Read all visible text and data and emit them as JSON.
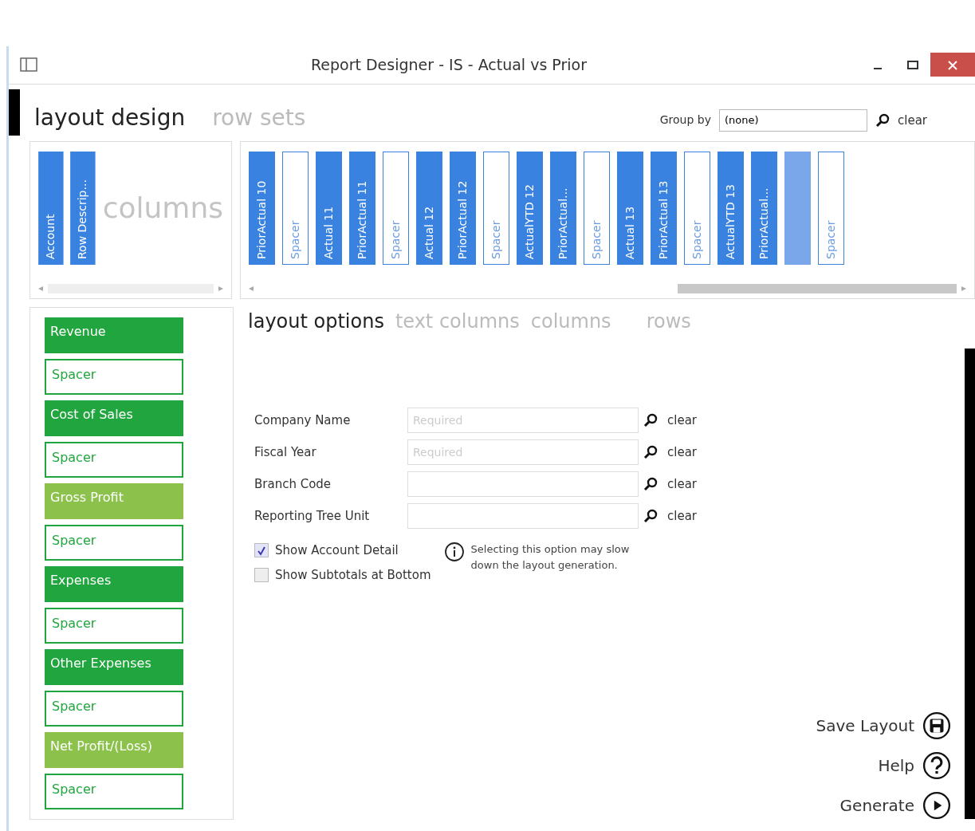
{
  "window": {
    "title": "Report Designer - IS - Actual vs Prior"
  },
  "main_tabs": [
    {
      "label": "layout design",
      "selected": true
    },
    {
      "label": "row sets",
      "selected": false
    }
  ],
  "group_by": {
    "label": "Group by",
    "value": "(none)",
    "clear": "clear"
  },
  "text_columns": {
    "placeholder": "columns",
    "items": [
      {
        "label": "Account",
        "kind": "column",
        "selected": false
      },
      {
        "label": "Row Descrip...",
        "kind": "column",
        "selected": false
      }
    ]
  },
  "columns": [
    {
      "label": "PriorActual 10",
      "kind": "column",
      "selected": false
    },
    {
      "label": "Spacer",
      "kind": "spacer",
      "selected": false
    },
    {
      "label": "Actual 11",
      "kind": "column",
      "selected": false
    },
    {
      "label": "PriorActual 11",
      "kind": "column",
      "selected": false
    },
    {
      "label": "Spacer",
      "kind": "spacer",
      "selected": false
    },
    {
      "label": "Actual 12",
      "kind": "column",
      "selected": false
    },
    {
      "label": "PriorActual 12",
      "kind": "column",
      "selected": false
    },
    {
      "label": "Spacer",
      "kind": "spacer",
      "selected": false
    },
    {
      "label": "ActualYTD 12",
      "kind": "column",
      "selected": false
    },
    {
      "label": "PriorActual...",
      "kind": "column",
      "selected": false
    },
    {
      "label": "Spacer",
      "kind": "spacer",
      "selected": false
    },
    {
      "label": "Actual 13",
      "kind": "column",
      "selected": false
    },
    {
      "label": "PriorActual 13",
      "kind": "column",
      "selected": false
    },
    {
      "label": "Spacer",
      "kind": "spacer",
      "selected": false
    },
    {
      "label": "ActualYTD 13",
      "kind": "column",
      "selected": false
    },
    {
      "label": "PriorActual...",
      "kind": "column",
      "selected": false
    },
    {
      "kind": "column",
      "selected": true
    },
    {
      "label": "Spacer",
      "kind": "spacer",
      "selected": false
    }
  ],
  "rows": [
    {
      "label": "Revenue",
      "kind": "total"
    },
    {
      "label": "Spacer",
      "kind": "spacer"
    },
    {
      "label": "Cost of Sales",
      "kind": "total"
    },
    {
      "label": "Spacer",
      "kind": "spacer"
    },
    {
      "label": "Gross Profit",
      "kind": "subtotal"
    },
    {
      "label": "Spacer",
      "kind": "spacer"
    },
    {
      "label": "Expenses",
      "kind": "total"
    },
    {
      "label": "Spacer",
      "kind": "spacer"
    },
    {
      "label": "Other Expenses",
      "kind": "total"
    },
    {
      "label": "Spacer",
      "kind": "spacer"
    },
    {
      "label": "Net Profit/(Loss)",
      "kind": "subtotal"
    },
    {
      "label": "Spacer",
      "kind": "spacer"
    }
  ],
  "option_tabs": [
    {
      "label": "layout options",
      "selected": true
    },
    {
      "label": "text columns",
      "selected": false
    },
    {
      "label": "columns",
      "selected": false
    },
    {
      "label": "rows",
      "selected": false
    }
  ],
  "fields": [
    {
      "label": "Company Name",
      "placeholder": "Required",
      "clear": "clear"
    },
    {
      "label": "Fiscal Year",
      "placeholder": "Required",
      "clear": "clear"
    },
    {
      "label": "Branch Code",
      "clear": "clear"
    },
    {
      "label": "Reporting Tree Unit",
      "clear": "clear"
    }
  ],
  "checkboxes": [
    {
      "label": "Show Account Detail",
      "checked": true
    },
    {
      "label": "Show Subtotals at Bottom",
      "checked": false
    }
  ],
  "info_note": "Selecting this option may slow down the layout generation.",
  "actions": [
    {
      "label": "Save Layout",
      "kind": "save"
    },
    {
      "label": "Help",
      "kind": "help"
    },
    {
      "label": "Generate",
      "kind": "generate"
    }
  ]
}
